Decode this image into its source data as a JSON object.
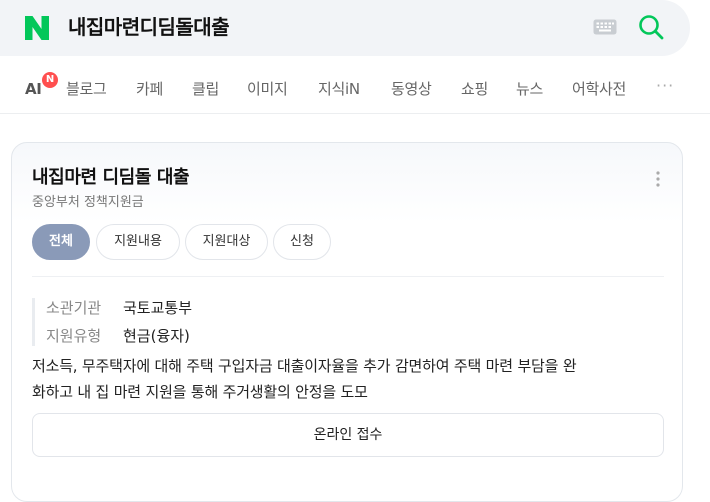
{
  "search": {
    "logo": "N",
    "query": "내집마련디딤돌대출",
    "icons": {
      "logo": "naver-n-logo",
      "keyboard": "keyboard-icon",
      "search": "search-icon"
    },
    "accent_color": "#03c75a"
  },
  "tabs": {
    "ai_label": "AI",
    "ai_badge": "N",
    "items": [
      "블로그",
      "카페",
      "클립",
      "이미지",
      "지식iN",
      "동영상",
      "쇼핑",
      "뉴스",
      "어학사전"
    ],
    "more": "···"
  },
  "card": {
    "title": "내집마련 디딤돌 대출",
    "subtitle": "중앙부처 정책지원금",
    "chips": [
      {
        "label": "전체",
        "active": true
      },
      {
        "label": "지원내용",
        "active": false
      },
      {
        "label": "지원대상",
        "active": false
      },
      {
        "label": "신청",
        "active": false
      }
    ],
    "info": [
      {
        "label": "소관기관",
        "value": "국토교통부"
      },
      {
        "label": "지원유형",
        "value": "현금(융자)"
      }
    ],
    "description_line1": "저소득, 무주택자에 대해 주택 구입자금 대출이자율을 추가 감면하여 주택 마련 부담을 완",
    "description_line2": "화하고 내 집 마련 지원을 통해 주거생활의 안정을 도모",
    "apply_label": "온라인 접수"
  }
}
